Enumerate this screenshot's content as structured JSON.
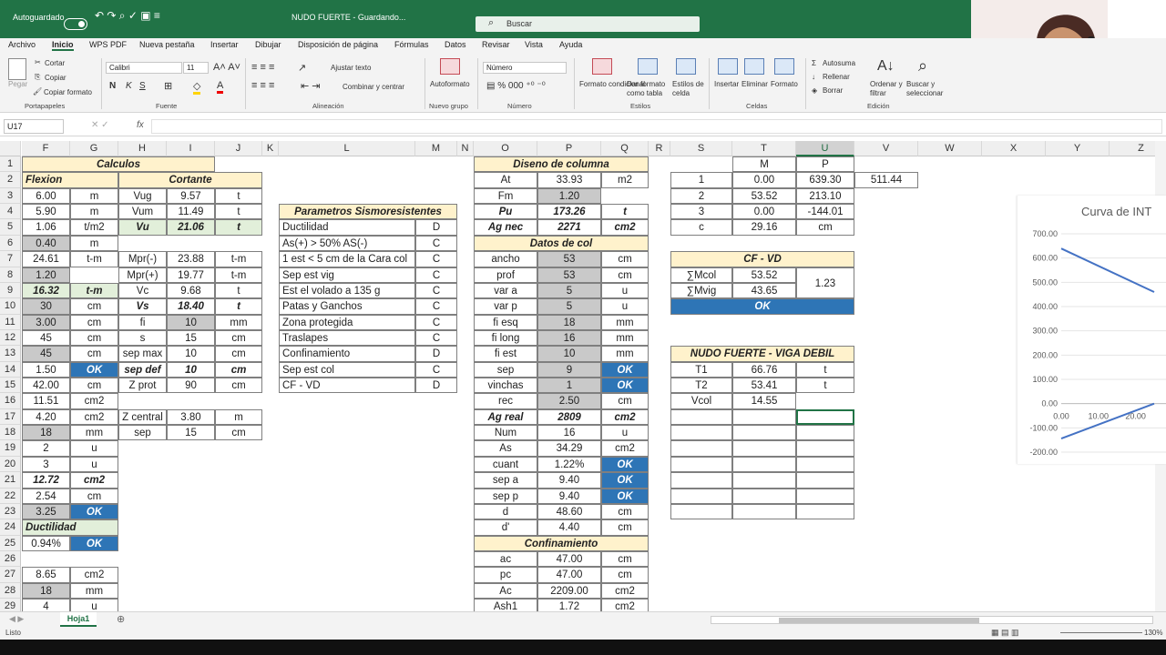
{
  "titlebar": {
    "autosave": "Autoguardado",
    "doc_title": "NUDO FUERTE  -  Guardando...",
    "search": "Buscar"
  },
  "menu": [
    "Archivo",
    "Inicio",
    "WPS PDF",
    "Nueva pestaña",
    "Insertar",
    "Dibujar",
    "Disposición de página",
    "Fórmulas",
    "Datos",
    "Revisar",
    "Vista",
    "Ayuda"
  ],
  "ribbon": {
    "clipboard": {
      "paste": "Pegar",
      "cut": "Cortar",
      "copy": "Copiar",
      "format": "Copiar formato",
      "group": "Portapapeles"
    },
    "font": {
      "name": "Calibri",
      "size": "11",
      "bold": "N",
      "italic": "K",
      "underline": "S",
      "group": "Fuente"
    },
    "align": {
      "wrap": "Ajustar texto",
      "merge": "Combinar y centrar",
      "group": "Alineación"
    },
    "newgroup": {
      "label": "Autoformato",
      "group": "Nuevo grupo"
    },
    "number": {
      "format": "Número",
      "group": "Número"
    },
    "styles": {
      "cond": "Formato condicional",
      "table": "Dar formato como tabla",
      "cell": "Estilos de celda",
      "group": "Estilos"
    },
    "cells": {
      "insert": "Insertar",
      "delete": "Eliminar",
      "format": "Formato",
      "group": "Celdas"
    },
    "edit": {
      "autosum": "Autosuma",
      "fill": "Rellenar",
      "clear": "Borrar",
      "sort": "Ordenar y filtrar",
      "find": "Buscar y seleccionar",
      "group": "Edición"
    }
  },
  "formula_bar": {
    "cell_ref": "U17",
    "fx": "fx",
    "value": ""
  },
  "columns": [
    "F",
    "G",
    "H",
    "I",
    "J",
    "K",
    "L",
    "M",
    "N",
    "O",
    "P",
    "Q",
    "R",
    "S",
    "T",
    "U",
    "V",
    "W",
    "X",
    "Y",
    "Z"
  ],
  "rows": [
    1,
    2,
    3,
    4,
    5,
    6,
    7,
    8,
    9,
    10,
    11,
    12,
    13,
    14,
    15,
    16,
    17,
    18,
    19,
    20,
    21,
    22,
    23,
    24,
    25,
    26,
    27,
    28,
    29
  ],
  "cells": [
    {
      "r": 1,
      "c": "F",
      "w": 4,
      "v": "Calculos",
      "s": "y bi"
    },
    {
      "r": 2,
      "c": "F",
      "w": 2,
      "v": "Flexion",
      "s": "y bi l"
    },
    {
      "r": 2,
      "c": "H",
      "w": 3,
      "v": "Cortante",
      "s": "y bi"
    },
    {
      "r": 3,
      "c": "F",
      "v": "6.00"
    },
    {
      "r": 3,
      "c": "G",
      "v": "m"
    },
    {
      "r": 3,
      "c": "H",
      "v": "Vug"
    },
    {
      "r": 3,
      "c": "I",
      "v": "9.57"
    },
    {
      "r": 3,
      "c": "J",
      "v": "t"
    },
    {
      "r": 4,
      "c": "F",
      "v": "5.90"
    },
    {
      "r": 4,
      "c": "G",
      "v": "m"
    },
    {
      "r": 4,
      "c": "H",
      "v": "Vum"
    },
    {
      "r": 4,
      "c": "I",
      "v": "11.49"
    },
    {
      "r": 4,
      "c": "J",
      "v": "t"
    },
    {
      "r": 5,
      "c": "F",
      "v": "1.06"
    },
    {
      "r": 5,
      "c": "G",
      "v": "t/m2"
    },
    {
      "r": 5,
      "c": "H",
      "v": "Vu",
      "s": "gr bi"
    },
    {
      "r": 5,
      "c": "I",
      "v": "21.06",
      "s": "gr bi"
    },
    {
      "r": 5,
      "c": "J",
      "v": "t",
      "s": "gr bi"
    },
    {
      "r": 6,
      "c": "F",
      "v": "0.40",
      "s": "g"
    },
    {
      "r": 6,
      "c": "G",
      "v": "m"
    },
    {
      "r": 7,
      "c": "F",
      "v": "24.61"
    },
    {
      "r": 7,
      "c": "G",
      "v": "t-m"
    },
    {
      "r": 7,
      "c": "H",
      "v": "Mpr(-)"
    },
    {
      "r": 7,
      "c": "I",
      "v": "23.88"
    },
    {
      "r": 7,
      "c": "J",
      "v": "t-m"
    },
    {
      "r": 8,
      "c": "F",
      "v": "1.20",
      "s": "g"
    },
    {
      "r": 8,
      "c": "H",
      "v": "Mpr(+)"
    },
    {
      "r": 8,
      "c": "I",
      "v": "19.77"
    },
    {
      "r": 8,
      "c": "J",
      "v": "t-m"
    },
    {
      "r": 9,
      "c": "F",
      "v": "16.32",
      "s": "gr bi"
    },
    {
      "r": 9,
      "c": "G",
      "v": "t-m",
      "s": "gr bi"
    },
    {
      "r": 9,
      "c": "H",
      "v": "Vc"
    },
    {
      "r": 9,
      "c": "I",
      "v": "9.68"
    },
    {
      "r": 9,
      "c": "J",
      "v": "t"
    },
    {
      "r": 10,
      "c": "F",
      "v": "30",
      "s": "g"
    },
    {
      "r": 10,
      "c": "G",
      "v": "cm"
    },
    {
      "r": 10,
      "c": "H",
      "v": "Vs",
      "s": "bi"
    },
    {
      "r": 10,
      "c": "I",
      "v": "18.40",
      "s": "bi"
    },
    {
      "r": 10,
      "c": "J",
      "v": "t",
      "s": "bi"
    },
    {
      "r": 11,
      "c": "F",
      "v": "3.00",
      "s": "g"
    },
    {
      "r": 11,
      "c": "G",
      "v": "cm"
    },
    {
      "r": 11,
      "c": "H",
      "v": "fi"
    },
    {
      "r": 11,
      "c": "I",
      "v": "10",
      "s": "g"
    },
    {
      "r": 11,
      "c": "J",
      "v": "mm"
    },
    {
      "r": 12,
      "c": "F",
      "v": "45"
    },
    {
      "r": 12,
      "c": "G",
      "v": "cm"
    },
    {
      "r": 12,
      "c": "H",
      "v": "s"
    },
    {
      "r": 12,
      "c": "I",
      "v": "15"
    },
    {
      "r": 12,
      "c": "J",
      "v": "cm"
    },
    {
      "r": 13,
      "c": "F",
      "v": "45",
      "s": "g"
    },
    {
      "r": 13,
      "c": "G",
      "v": "cm"
    },
    {
      "r": 13,
      "c": "H",
      "v": "sep max"
    },
    {
      "r": 13,
      "c": "I",
      "v": "10"
    },
    {
      "r": 13,
      "c": "J",
      "v": "cm"
    },
    {
      "r": 14,
      "c": "F",
      "v": "1.50"
    },
    {
      "r": 14,
      "c": "G",
      "v": "OK",
      "s": "ok"
    },
    {
      "r": 14,
      "c": "H",
      "v": "sep def",
      "s": "bi"
    },
    {
      "r": 14,
      "c": "I",
      "v": "10",
      "s": "bi"
    },
    {
      "r": 14,
      "c": "J",
      "v": "cm",
      "s": "bi"
    },
    {
      "r": 15,
      "c": "F",
      "v": "42.00"
    },
    {
      "r": 15,
      "c": "G",
      "v": "cm"
    },
    {
      "r": 15,
      "c": "H",
      "v": "Z prot"
    },
    {
      "r": 15,
      "c": "I",
      "v": "90"
    },
    {
      "r": 15,
      "c": "J",
      "v": "cm"
    },
    {
      "r": 16,
      "c": "F",
      "v": "11.51"
    },
    {
      "r": 16,
      "c": "G",
      "v": "cm2"
    },
    {
      "r": 17,
      "c": "F",
      "v": "4.20"
    },
    {
      "r": 17,
      "c": "G",
      "v": "cm2"
    },
    {
      "r": 17,
      "c": "H",
      "v": "Z central"
    },
    {
      "r": 17,
      "c": "I",
      "v": "3.80"
    },
    {
      "r": 17,
      "c": "J",
      "v": "m"
    },
    {
      "r": 18,
      "c": "F",
      "v": "18",
      "s": "g"
    },
    {
      "r": 18,
      "c": "G",
      "v": "mm"
    },
    {
      "r": 18,
      "c": "H",
      "v": "sep"
    },
    {
      "r": 18,
      "c": "I",
      "v": "15"
    },
    {
      "r": 18,
      "c": "J",
      "v": "cm"
    },
    {
      "r": 19,
      "c": "F",
      "v": "2"
    },
    {
      "r": 19,
      "c": "G",
      "v": "u"
    },
    {
      "r": 20,
      "c": "F",
      "v": "3"
    },
    {
      "r": 20,
      "c": "G",
      "v": "u"
    },
    {
      "r": 21,
      "c": "F",
      "v": "12.72",
      "s": "bi"
    },
    {
      "r": 21,
      "c": "G",
      "v": "cm2",
      "s": "bi"
    },
    {
      "r": 22,
      "c": "F",
      "v": "2.54"
    },
    {
      "r": 22,
      "c": "G",
      "v": "cm"
    },
    {
      "r": 23,
      "c": "F",
      "v": "3.25",
      "s": "g"
    },
    {
      "r": 23,
      "c": "G",
      "v": "OK",
      "s": "ok"
    },
    {
      "r": 24,
      "c": "F",
      "w": 2,
      "v": "Ductilidad",
      "s": "gr bi l"
    },
    {
      "r": 25,
      "c": "F",
      "v": "0.94%"
    },
    {
      "r": 25,
      "c": "G",
      "v": "OK",
      "s": "ok"
    },
    {
      "r": 27,
      "c": "F",
      "v": "8.65"
    },
    {
      "r": 27,
      "c": "G",
      "v": "cm2"
    },
    {
      "r": 28,
      "c": "F",
      "v": "18",
      "s": "g"
    },
    {
      "r": 28,
      "c": "G",
      "v": "mm"
    },
    {
      "r": 29,
      "c": "F",
      "v": "4"
    },
    {
      "r": 29,
      "c": "G",
      "v": "u"
    },
    {
      "r": 4,
      "c": "L",
      "w": 2,
      "v": "Parametros Sismoresistentes",
      "s": "y bi"
    },
    {
      "r": 5,
      "c": "L",
      "v": "Ductilidad",
      "s": "l"
    },
    {
      "r": 5,
      "c": "M",
      "v": "D"
    },
    {
      "r": 6,
      "c": "L",
      "v": "As(+) > 50% AS(-)",
      "s": "l"
    },
    {
      "r": 6,
      "c": "M",
      "v": "C"
    },
    {
      "r": 7,
      "c": "L",
      "v": "1 est < 5 cm de la Cara col",
      "s": "l"
    },
    {
      "r": 7,
      "c": "M",
      "v": "C"
    },
    {
      "r": 8,
      "c": "L",
      "v": "Sep est vig",
      "s": "l"
    },
    {
      "r": 8,
      "c": "M",
      "v": "C"
    },
    {
      "r": 9,
      "c": "L",
      "v": "Est el volado a 135 g",
      "s": "l"
    },
    {
      "r": 9,
      "c": "M",
      "v": "C"
    },
    {
      "r": 10,
      "c": "L",
      "v": "Patas y Ganchos",
      "s": "l"
    },
    {
      "r": 10,
      "c": "M",
      "v": "C"
    },
    {
      "r": 11,
      "c": "L",
      "v": "Zona protegida",
      "s": "l"
    },
    {
      "r": 11,
      "c": "M",
      "v": "C"
    },
    {
      "r": 12,
      "c": "L",
      "v": "Traslapes",
      "s": "l"
    },
    {
      "r": 12,
      "c": "M",
      "v": "C"
    },
    {
      "r": 13,
      "c": "L",
      "v": "Confinamiento",
      "s": "l"
    },
    {
      "r": 13,
      "c": "M",
      "v": "D"
    },
    {
      "r": 14,
      "c": "L",
      "v": "Sep est col",
      "s": "l"
    },
    {
      "r": 14,
      "c": "M",
      "v": "C"
    },
    {
      "r": 15,
      "c": "L",
      "v": "CF - VD",
      "s": "l"
    },
    {
      "r": 15,
      "c": "M",
      "v": "D"
    },
    {
      "r": 1,
      "c": "O",
      "w": 3,
      "v": "Diseno de columna",
      "s": "y bi"
    },
    {
      "r": 2,
      "c": "O",
      "v": "At"
    },
    {
      "r": 2,
      "c": "P",
      "v": "33.93"
    },
    {
      "r": 2,
      "c": "Q",
      "v": "m2"
    },
    {
      "r": 3,
      "c": "O",
      "v": "Fm"
    },
    {
      "r": 3,
      "c": "P",
      "v": "1.20",
      "s": "g"
    },
    {
      "r": 4,
      "c": "O",
      "v": "Pu",
      "s": "bi"
    },
    {
      "r": 4,
      "c": "P",
      "v": "173.26",
      "s": "bi"
    },
    {
      "r": 4,
      "c": "Q",
      "v": "t",
      "s": "bi"
    },
    {
      "r": 5,
      "c": "O",
      "v": "Ag nec",
      "s": "bi"
    },
    {
      "r": 5,
      "c": "P",
      "v": "2271",
      "s": "bi"
    },
    {
      "r": 5,
      "c": "Q",
      "v": "cm2",
      "s": "bi"
    },
    {
      "r": 6,
      "c": "O",
      "w": 3,
      "v": "Datos de col",
      "s": "y bi"
    },
    {
      "r": 7,
      "c": "O",
      "v": "ancho"
    },
    {
      "r": 7,
      "c": "P",
      "v": "53",
      "s": "g"
    },
    {
      "r": 7,
      "c": "Q",
      "v": "cm"
    },
    {
      "r": 8,
      "c": "O",
      "v": "prof"
    },
    {
      "r": 8,
      "c": "P",
      "v": "53",
      "s": "g"
    },
    {
      "r": 8,
      "c": "Q",
      "v": "cm"
    },
    {
      "r": 9,
      "c": "O",
      "v": "var a"
    },
    {
      "r": 9,
      "c": "P",
      "v": "5",
      "s": "g"
    },
    {
      "r": 9,
      "c": "Q",
      "v": "u"
    },
    {
      "r": 10,
      "c": "O",
      "v": "var p"
    },
    {
      "r": 10,
      "c": "P",
      "v": "5",
      "s": "g"
    },
    {
      "r": 10,
      "c": "Q",
      "v": "u"
    },
    {
      "r": 11,
      "c": "O",
      "v": "fi esq"
    },
    {
      "r": 11,
      "c": "P",
      "v": "18",
      "s": "g"
    },
    {
      "r": 11,
      "c": "Q",
      "v": "mm"
    },
    {
      "r": 12,
      "c": "O",
      "v": "fi long"
    },
    {
      "r": 12,
      "c": "P",
      "v": "16",
      "s": "g"
    },
    {
      "r": 12,
      "c": "Q",
      "v": "mm"
    },
    {
      "r": 13,
      "c": "O",
      "v": "fi est"
    },
    {
      "r": 13,
      "c": "P",
      "v": "10",
      "s": "g"
    },
    {
      "r": 13,
      "c": "Q",
      "v": "mm"
    },
    {
      "r": 14,
      "c": "O",
      "v": "sep"
    },
    {
      "r": 14,
      "c": "P",
      "v": "9",
      "s": "g"
    },
    {
      "r": 14,
      "c": "Q",
      "v": "OK",
      "s": "ok"
    },
    {
      "r": 15,
      "c": "O",
      "v": "vinchas"
    },
    {
      "r": 15,
      "c": "P",
      "v": "1",
      "s": "g"
    },
    {
      "r": 15,
      "c": "Q",
      "v": "OK",
      "s": "ok"
    },
    {
      "r": 16,
      "c": "O",
      "v": "rec"
    },
    {
      "r": 16,
      "c": "P",
      "v": "2.50",
      "s": "g"
    },
    {
      "r": 16,
      "c": "Q",
      "v": "cm"
    },
    {
      "r": 17,
      "c": "O",
      "v": "Ag real",
      "s": "bi"
    },
    {
      "r": 17,
      "c": "P",
      "v": "2809",
      "s": "bi"
    },
    {
      "r": 17,
      "c": "Q",
      "v": "cm2",
      "s": "bi"
    },
    {
      "r": 18,
      "c": "O",
      "v": "Num"
    },
    {
      "r": 18,
      "c": "P",
      "v": "16"
    },
    {
      "r": 18,
      "c": "Q",
      "v": "u"
    },
    {
      "r": 19,
      "c": "O",
      "v": "As"
    },
    {
      "r": 19,
      "c": "P",
      "v": "34.29"
    },
    {
      "r": 19,
      "c": "Q",
      "v": "cm2"
    },
    {
      "r": 20,
      "c": "O",
      "v": "cuant"
    },
    {
      "r": 20,
      "c": "P",
      "v": "1.22%"
    },
    {
      "r": 20,
      "c": "Q",
      "v": "OK",
      "s": "ok"
    },
    {
      "r": 21,
      "c": "O",
      "v": "sep a"
    },
    {
      "r": 21,
      "c": "P",
      "v": "9.40"
    },
    {
      "r": 21,
      "c": "Q",
      "v": "OK",
      "s": "ok"
    },
    {
      "r": 22,
      "c": "O",
      "v": "sep p"
    },
    {
      "r": 22,
      "c": "P",
      "v": "9.40"
    },
    {
      "r": 22,
      "c": "Q",
      "v": "OK",
      "s": "ok"
    },
    {
      "r": 23,
      "c": "O",
      "v": "d"
    },
    {
      "r": 23,
      "c": "P",
      "v": "48.60"
    },
    {
      "r": 23,
      "c": "Q",
      "v": "cm"
    },
    {
      "r": 24,
      "c": "O",
      "v": "d'"
    },
    {
      "r": 24,
      "c": "P",
      "v": "4.40"
    },
    {
      "r": 24,
      "c": "Q",
      "v": "cm"
    },
    {
      "r": 25,
      "c": "O",
      "w": 3,
      "v": "Confinamiento",
      "s": "y bi"
    },
    {
      "r": 26,
      "c": "O",
      "v": "ac"
    },
    {
      "r": 26,
      "c": "P",
      "v": "47.00"
    },
    {
      "r": 26,
      "c": "Q",
      "v": "cm"
    },
    {
      "r": 27,
      "c": "O",
      "v": "pc"
    },
    {
      "r": 27,
      "c": "P",
      "v": "47.00"
    },
    {
      "r": 27,
      "c": "Q",
      "v": "cm"
    },
    {
      "r": 28,
      "c": "O",
      "v": "Ac"
    },
    {
      "r": 28,
      "c": "P",
      "v": "2209.00"
    },
    {
      "r": 28,
      "c": "Q",
      "v": "cm2"
    },
    {
      "r": 29,
      "c": "O",
      "v": "Ash1"
    },
    {
      "r": 29,
      "c": "P",
      "v": "1.72"
    },
    {
      "r": 29,
      "c": "Q",
      "v": "cm2"
    },
    {
      "r": 1,
      "c": "T",
      "v": "M"
    },
    {
      "r": 1,
      "c": "U",
      "v": "P"
    },
    {
      "r": 2,
      "c": "S",
      "v": "1"
    },
    {
      "r": 2,
      "c": "T",
      "v": "0.00"
    },
    {
      "r": 2,
      "c": "U",
      "v": "639.30"
    },
    {
      "r": 2,
      "c": "V",
      "v": "511.44"
    },
    {
      "r": 3,
      "c": "S",
      "v": "2"
    },
    {
      "r": 3,
      "c": "T",
      "v": "53.52"
    },
    {
      "r": 3,
      "c": "U",
      "v": "213.10"
    },
    {
      "r": 4,
      "c": "S",
      "v": "3"
    },
    {
      "r": 4,
      "c": "T",
      "v": "0.00"
    },
    {
      "r": 4,
      "c": "U",
      "v": "-144.01"
    },
    {
      "r": 5,
      "c": "S",
      "v": "c"
    },
    {
      "r": 5,
      "c": "T",
      "v": "29.16"
    },
    {
      "r": 5,
      "c": "U",
      "v": "cm"
    },
    {
      "r": 7,
      "c": "S",
      "w": 3,
      "v": "CF - VD",
      "s": "y bi"
    },
    {
      "r": 8,
      "c": "S",
      "v": "∑Mcol"
    },
    {
      "r": 8,
      "c": "T",
      "v": "53.52"
    },
    {
      "r": 9,
      "c": "S",
      "v": "∑Mvig"
    },
    {
      "r": 9,
      "c": "T",
      "v": "43.65"
    },
    {
      "r": 8,
      "c": "U",
      "h": 2,
      "v": "1.23"
    },
    {
      "r": 10,
      "c": "S",
      "w": 3,
      "v": "OK",
      "s": "ok"
    },
    {
      "r": 13,
      "c": "S",
      "w": 3,
      "v": "NUDO FUERTE - VIGA DEBIL",
      "s": "y bi"
    },
    {
      "r": 14,
      "c": "S",
      "v": "T1"
    },
    {
      "r": 14,
      "c": "T",
      "v": "66.76"
    },
    {
      "r": 14,
      "c": "U",
      "v": "t"
    },
    {
      "r": 15,
      "c": "S",
      "v": "T2"
    },
    {
      "r": 15,
      "c": "T",
      "v": "53.41"
    },
    {
      "r": 15,
      "c": "U",
      "v": "t"
    },
    {
      "r": 16,
      "c": "S",
      "v": "Vcol"
    },
    {
      "r": 16,
      "c": "T",
      "v": "14.55"
    }
  ],
  "chart_data": {
    "type": "line",
    "title": "Curva de INT",
    "yticks": [
      "700.00",
      "600.00",
      "500.00",
      "400.00",
      "300.00",
      "200.00",
      "100.00",
      "0.00",
      "-100.00",
      "-200.00"
    ],
    "xticks": [
      "0.00",
      "10.00",
      "20.00"
    ],
    "ylim": [
      -200,
      700
    ],
    "xlim": [
      0,
      25
    ],
    "series": [
      {
        "points": [
          [
            0,
            639.3
          ],
          [
            25,
            460
          ]
        ]
      },
      {
        "points": [
          [
            0,
            -144.01
          ],
          [
            25,
            0
          ]
        ]
      }
    ]
  },
  "sheet": {
    "tab": "Hoja1"
  },
  "status": {
    "left": "Listo",
    "zoom": "130%"
  }
}
